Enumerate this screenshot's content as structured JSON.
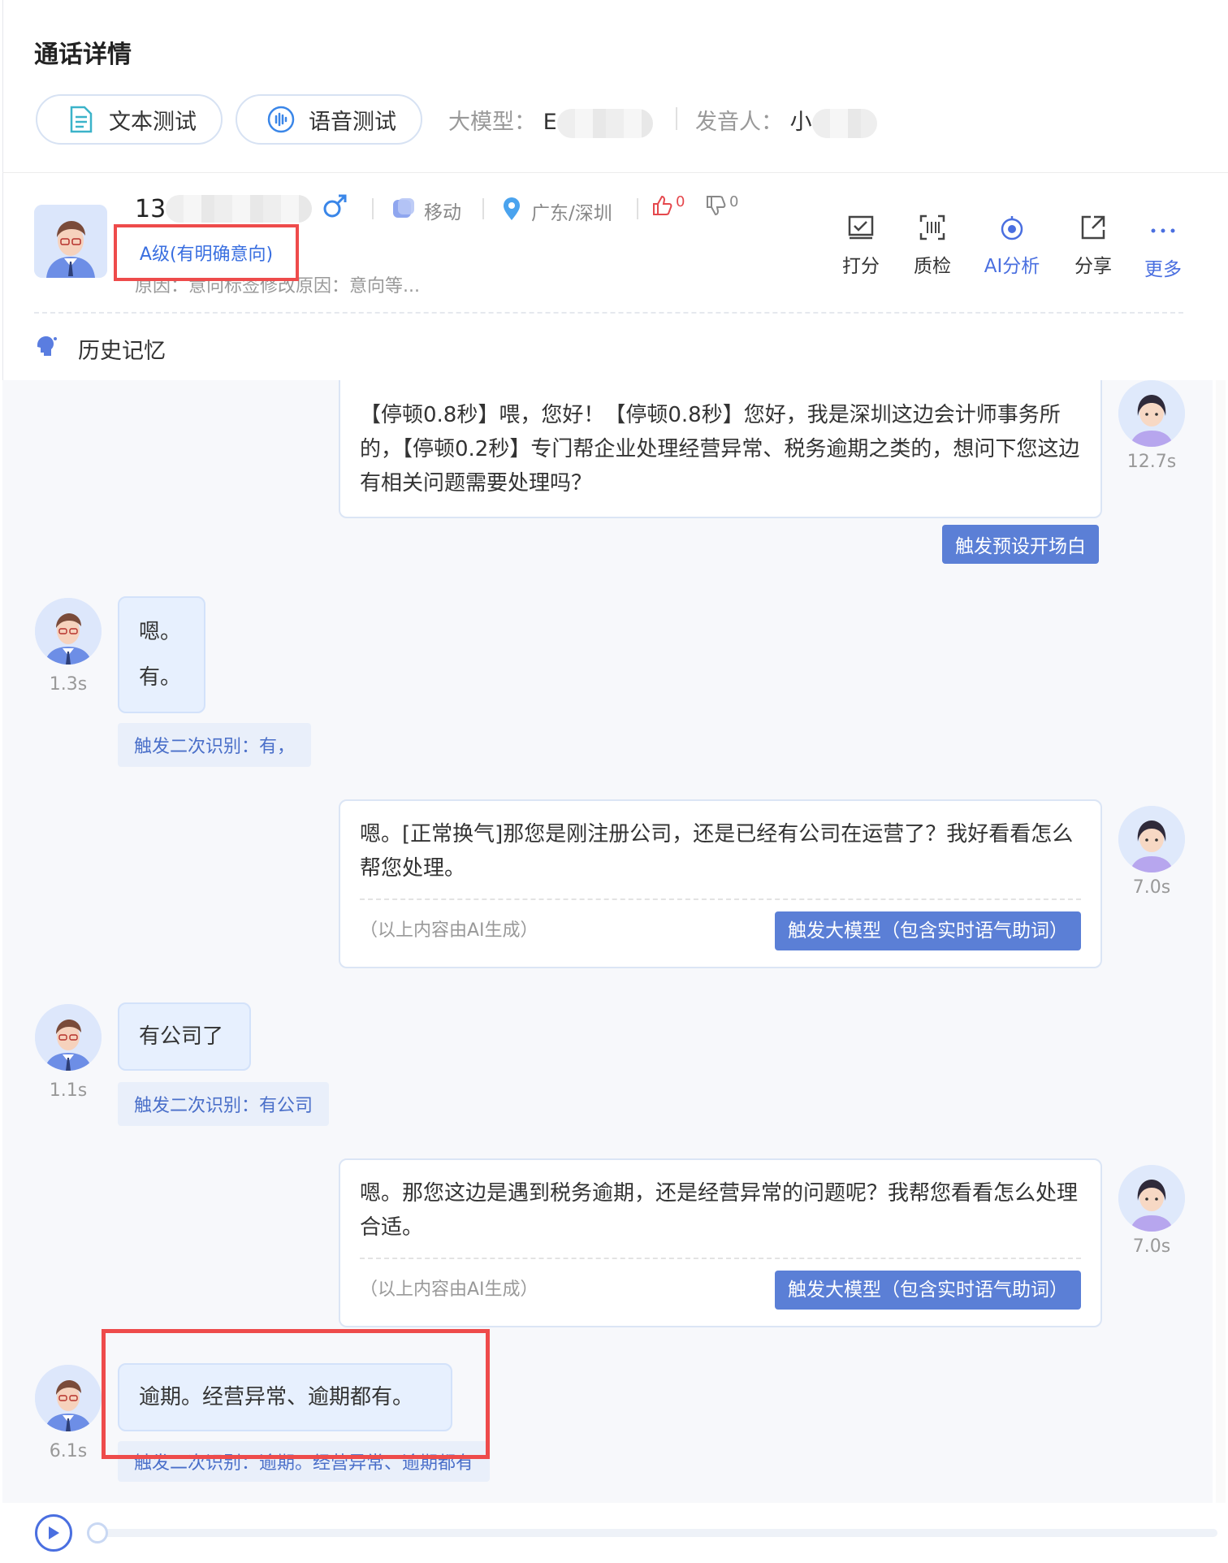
{
  "header": {
    "title": "通话详情",
    "text_test_label": "文本测试",
    "voice_test_label": "语音测试",
    "model_label": "大模型：",
    "model_value": "E",
    "speaker_label": "发音人：",
    "speaker_value": "小"
  },
  "profile": {
    "phone": "13",
    "gender_icon": "male-icon",
    "carrier": "移动",
    "location": "广东/深圳",
    "likes": "0",
    "dislikes": "0",
    "grade": "A级(有明确意向)",
    "reason": "原因：意向标签修改原因：意向等..."
  },
  "actions": [
    {
      "label": "打分",
      "icon": "score-icon"
    },
    {
      "label": "质检",
      "icon": "inspect-icon"
    },
    {
      "label": "AI分析",
      "icon": "ai-analysis-icon"
    },
    {
      "label": "分享",
      "icon": "share-icon"
    },
    {
      "label": "更多",
      "icon": "more-icon"
    }
  ],
  "memory_label": "历史记忆",
  "messages": [
    {
      "role": "bot",
      "text": "【停顿0.8秒】喂，您好！【停顿0.8秒】您好，我是深圳这边会计师事务所的，【停顿0.2秒】专门帮企业处理经营异常、税务逾期之类的，想问下您这边有相关问题需要处理吗？",
      "duration": "12.7s",
      "tag": "触发预设开场白"
    },
    {
      "role": "user",
      "text_lines": [
        "嗯。",
        "有。"
      ],
      "duration": "1.3s",
      "tag": "触发二次识别：有，"
    },
    {
      "role": "bot",
      "text": "嗯。[正常换气]那您是刚注册公司，还是已经有公司在运营了？我好看看怎么帮您处理。",
      "duration": "7.0s",
      "note": "（以上内容由AI生成）",
      "tag": "触发大模型（包含实时语气助词）"
    },
    {
      "role": "user",
      "text": "有公司了",
      "duration": "1.1s",
      "tag": "触发二次识别：有公司"
    },
    {
      "role": "bot",
      "text": "嗯。那您这边是遇到税务逾期，还是经营异常的问题呢？我帮您看看怎么处理合适。",
      "duration": "7.0s",
      "note": "（以上内容由AI生成）",
      "tag": "触发大模型（包含实时语气助词）"
    },
    {
      "role": "user",
      "text": "逾期。经营异常、逾期都有。",
      "duration": "6.1s",
      "tag": "触发二次识别：逾期。经营异常、逾期都有"
    }
  ],
  "colors": {
    "accent": "#4a6fe0",
    "tag_bg": "#5b7fd6",
    "highlight": "#ee4b4b"
  }
}
